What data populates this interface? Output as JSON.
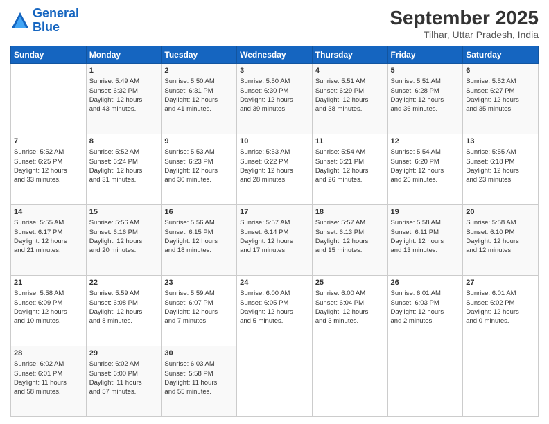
{
  "logo": {
    "line1": "General",
    "line2": "Blue"
  },
  "header": {
    "month": "September 2025",
    "location": "Tilhar, Uttar Pradesh, India"
  },
  "weekdays": [
    "Sunday",
    "Monday",
    "Tuesday",
    "Wednesday",
    "Thursday",
    "Friday",
    "Saturday"
  ],
  "weeks": [
    [
      {
        "day": "",
        "info": ""
      },
      {
        "day": "1",
        "info": "Sunrise: 5:49 AM\nSunset: 6:32 PM\nDaylight: 12 hours\nand 43 minutes."
      },
      {
        "day": "2",
        "info": "Sunrise: 5:50 AM\nSunset: 6:31 PM\nDaylight: 12 hours\nand 41 minutes."
      },
      {
        "day": "3",
        "info": "Sunrise: 5:50 AM\nSunset: 6:30 PM\nDaylight: 12 hours\nand 39 minutes."
      },
      {
        "day": "4",
        "info": "Sunrise: 5:51 AM\nSunset: 6:29 PM\nDaylight: 12 hours\nand 38 minutes."
      },
      {
        "day": "5",
        "info": "Sunrise: 5:51 AM\nSunset: 6:28 PM\nDaylight: 12 hours\nand 36 minutes."
      },
      {
        "day": "6",
        "info": "Sunrise: 5:52 AM\nSunset: 6:27 PM\nDaylight: 12 hours\nand 35 minutes."
      }
    ],
    [
      {
        "day": "7",
        "info": "Sunrise: 5:52 AM\nSunset: 6:25 PM\nDaylight: 12 hours\nand 33 minutes."
      },
      {
        "day": "8",
        "info": "Sunrise: 5:52 AM\nSunset: 6:24 PM\nDaylight: 12 hours\nand 31 minutes."
      },
      {
        "day": "9",
        "info": "Sunrise: 5:53 AM\nSunset: 6:23 PM\nDaylight: 12 hours\nand 30 minutes."
      },
      {
        "day": "10",
        "info": "Sunrise: 5:53 AM\nSunset: 6:22 PM\nDaylight: 12 hours\nand 28 minutes."
      },
      {
        "day": "11",
        "info": "Sunrise: 5:54 AM\nSunset: 6:21 PM\nDaylight: 12 hours\nand 26 minutes."
      },
      {
        "day": "12",
        "info": "Sunrise: 5:54 AM\nSunset: 6:20 PM\nDaylight: 12 hours\nand 25 minutes."
      },
      {
        "day": "13",
        "info": "Sunrise: 5:55 AM\nSunset: 6:18 PM\nDaylight: 12 hours\nand 23 minutes."
      }
    ],
    [
      {
        "day": "14",
        "info": "Sunrise: 5:55 AM\nSunset: 6:17 PM\nDaylight: 12 hours\nand 21 minutes."
      },
      {
        "day": "15",
        "info": "Sunrise: 5:56 AM\nSunset: 6:16 PM\nDaylight: 12 hours\nand 20 minutes."
      },
      {
        "day": "16",
        "info": "Sunrise: 5:56 AM\nSunset: 6:15 PM\nDaylight: 12 hours\nand 18 minutes."
      },
      {
        "day": "17",
        "info": "Sunrise: 5:57 AM\nSunset: 6:14 PM\nDaylight: 12 hours\nand 17 minutes."
      },
      {
        "day": "18",
        "info": "Sunrise: 5:57 AM\nSunset: 6:13 PM\nDaylight: 12 hours\nand 15 minutes."
      },
      {
        "day": "19",
        "info": "Sunrise: 5:58 AM\nSunset: 6:11 PM\nDaylight: 12 hours\nand 13 minutes."
      },
      {
        "day": "20",
        "info": "Sunrise: 5:58 AM\nSunset: 6:10 PM\nDaylight: 12 hours\nand 12 minutes."
      }
    ],
    [
      {
        "day": "21",
        "info": "Sunrise: 5:58 AM\nSunset: 6:09 PM\nDaylight: 12 hours\nand 10 minutes."
      },
      {
        "day": "22",
        "info": "Sunrise: 5:59 AM\nSunset: 6:08 PM\nDaylight: 12 hours\nand 8 minutes."
      },
      {
        "day": "23",
        "info": "Sunrise: 5:59 AM\nSunset: 6:07 PM\nDaylight: 12 hours\nand 7 minutes."
      },
      {
        "day": "24",
        "info": "Sunrise: 6:00 AM\nSunset: 6:05 PM\nDaylight: 12 hours\nand 5 minutes."
      },
      {
        "day": "25",
        "info": "Sunrise: 6:00 AM\nSunset: 6:04 PM\nDaylight: 12 hours\nand 3 minutes."
      },
      {
        "day": "26",
        "info": "Sunrise: 6:01 AM\nSunset: 6:03 PM\nDaylight: 12 hours\nand 2 minutes."
      },
      {
        "day": "27",
        "info": "Sunrise: 6:01 AM\nSunset: 6:02 PM\nDaylight: 12 hours\nand 0 minutes."
      }
    ],
    [
      {
        "day": "28",
        "info": "Sunrise: 6:02 AM\nSunset: 6:01 PM\nDaylight: 11 hours\nand 58 minutes."
      },
      {
        "day": "29",
        "info": "Sunrise: 6:02 AM\nSunset: 6:00 PM\nDaylight: 11 hours\nand 57 minutes."
      },
      {
        "day": "30",
        "info": "Sunrise: 6:03 AM\nSunset: 5:58 PM\nDaylight: 11 hours\nand 55 minutes."
      },
      {
        "day": "",
        "info": ""
      },
      {
        "day": "",
        "info": ""
      },
      {
        "day": "",
        "info": ""
      },
      {
        "day": "",
        "info": ""
      }
    ]
  ]
}
